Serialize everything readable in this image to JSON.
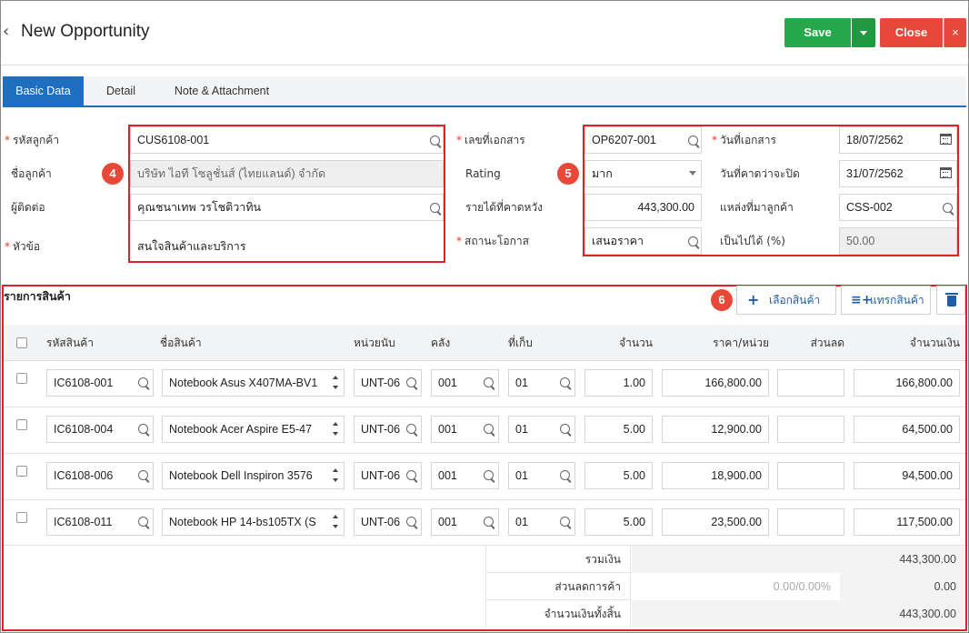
{
  "header": {
    "title": "New Opportunity",
    "save_label": "Save",
    "close_label": "Close",
    "close_x": "×"
  },
  "tabs": [
    {
      "label": "Basic Data",
      "active": true
    },
    {
      "label": "Detail",
      "active": false
    },
    {
      "label": "Note & Attachment",
      "active": false
    }
  ],
  "form_left": {
    "customer_code_label": "รหัสลูกค้า",
    "customer_code_value": "CUS6108-001",
    "customer_name_label": "ชื่อลูกค้า",
    "customer_name_value": "บริษัท ไอที โซลูชั่นส์ (ไทยแลนด์) จำกัด",
    "contact_label": "ผู้ติดต่อ",
    "contact_value": "คุณชนาเทพ วรโชติวาทิน",
    "subject_label": "หัวข้อ",
    "subject_value": "สนใจสินค้าและบริการ"
  },
  "form_mid": {
    "doc_no_label": "เลขที่เอกสาร",
    "doc_no_value": "OP6207-001",
    "rating_label": "Rating",
    "rating_value": "มาก",
    "expected_revenue_label": "รายได้ที่คาดหวัง",
    "expected_revenue_value": "443,300.00",
    "status_label": "สถานะโอกาส",
    "status_value": "เสนอราคา"
  },
  "form_right": {
    "doc_date_label": "วันที่เอกสาร",
    "doc_date_value": "18/07/2562",
    "expected_close_label": "วันที่คาดว่าจะปิด",
    "expected_close_value": "31/07/2562",
    "source_label": "แหล่งที่มาลูกค้า",
    "source_value": "CSS-002",
    "probability_label": "เป็นไปได้ (%)",
    "probability_value": "50.00"
  },
  "steps": {
    "four": "4",
    "five": "5",
    "six": "6"
  },
  "products": {
    "title": "รายการสินค้า",
    "select_label": "เลือกสินค้า",
    "insert_label": "แทรกสินค้า",
    "columns": {
      "code": "รหัสสินค้า",
      "name": "ชื่อสินค้า",
      "unit": "หน่วยนับ",
      "warehouse": "คลัง",
      "location": "ที่เก็บ",
      "qty": "จำนวน",
      "price": "ราคา/หน่วย",
      "discount": "ส่วนลด",
      "amount": "จำนวนเงิน"
    },
    "rows": [
      {
        "code": "IC6108-001",
        "name": "Notebook Asus X407MA-BV1",
        "unit": "UNT-06",
        "warehouse": "001",
        "location": "01",
        "qty": "1.00",
        "price": "166,800.00",
        "discount": "",
        "amount": "166,800.00"
      },
      {
        "code": "IC6108-004",
        "name": "Notebook Acer Aspire E5-47",
        "unit": "UNT-06",
        "warehouse": "001",
        "location": "01",
        "qty": "5.00",
        "price": "12,900.00",
        "discount": "",
        "amount": "64,500.00"
      },
      {
        "code": "IC6108-006",
        "name": "Notebook Dell Inspiron 3576",
        "unit": "UNT-06",
        "warehouse": "001",
        "location": "01",
        "qty": "5.00",
        "price": "18,900.00",
        "discount": "",
        "amount": "94,500.00"
      },
      {
        "code": "IC6108-011",
        "name": "Notebook HP 14-bs105TX (S",
        "unit": "UNT-06",
        "warehouse": "001",
        "location": "01",
        "qty": "5.00",
        "price": "23,500.00",
        "discount": "",
        "amount": "117,500.00"
      }
    ]
  },
  "summary": {
    "total_label": "รวมเงิน",
    "total_value": "443,300.00",
    "discount_label": "ส่วนลดการค้า",
    "discount_input": "0.00/0.00%",
    "discount_value": "0.00",
    "grand_label": "จำนวนเงินทั้งสิ้น",
    "grand_value": "443,300.00"
  },
  "colors": {
    "accent": "#1e6fc0",
    "save": "#27a84a",
    "close": "#e8483a",
    "annotation": "#e0202a"
  }
}
